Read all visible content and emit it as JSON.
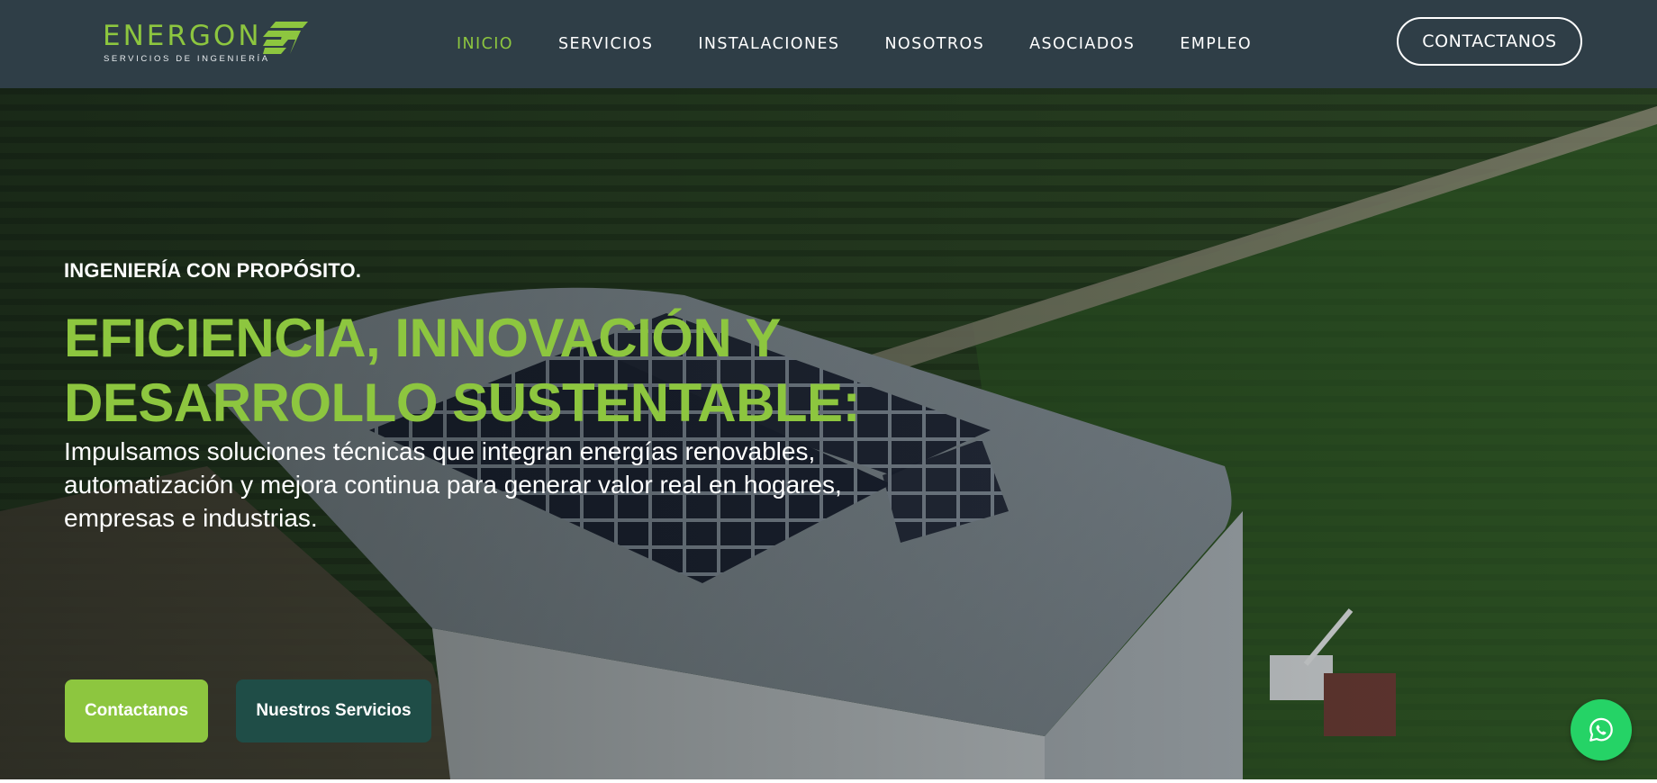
{
  "brand": {
    "name": "ENERGON",
    "tagline": "SERVICIOS DE INGENIERÍA",
    "accent_color": "#8dc63f",
    "header_bg": "#2f3e47"
  },
  "nav": {
    "items": [
      {
        "label": "INICIO",
        "active": true
      },
      {
        "label": "SERVICIOS",
        "active": false
      },
      {
        "label": "INSTALACIONES",
        "active": false
      },
      {
        "label": "NOSOTROS",
        "active": false
      },
      {
        "label": "ASOCIADOS",
        "active": false
      },
      {
        "label": "EMPLEO",
        "active": false
      }
    ],
    "cta_label": "CONTACTANOS"
  },
  "hero": {
    "eyebrow": "INGENIERÍA CON PROPÓSITO.",
    "headline_line1": "EFICIENCIA, INNOVACIÓN Y",
    "headline_line2": "DESARROLLO SUSTENTABLE:",
    "lead_line1": "Impulsamos soluciones técnicas que integran energías renovables,",
    "lead_line2": "automatización y mejora continua para generar valor real en hogares,",
    "lead_line3": "empresas e industrias.",
    "primary_button": "Contactanos",
    "secondary_button": "Nuestros Servicios",
    "secondary_button_color": "#1f4d47",
    "background_icon": "aerial-solar-roof-photo"
  },
  "floating": {
    "icon": "whatsapp-icon",
    "color": "#25d366"
  }
}
